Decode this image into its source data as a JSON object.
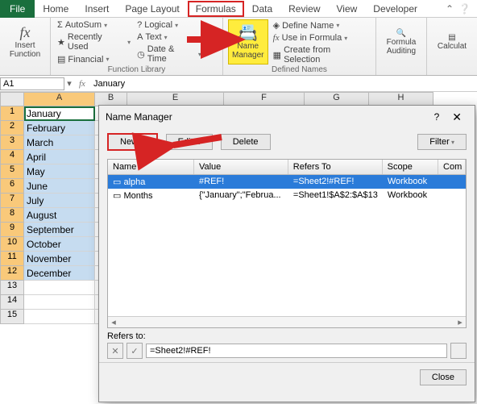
{
  "tabs": {
    "file": "File",
    "home": "Home",
    "insert": "Insert",
    "pagelayout": "Page Layout",
    "formulas": "Formulas",
    "data": "Data",
    "review": "Review",
    "view": "View",
    "developer": "Developer"
  },
  "ribbon": {
    "insert_function": "Insert Function",
    "autosum": "AutoSum",
    "recently": "Recently Used",
    "financial": "Financial",
    "logical": "Logical",
    "text": "Text",
    "datetime": "Date & Time",
    "group1": "Function Library",
    "name_manager": "Name Manager",
    "define": "Define Name",
    "usein": "Use in Formula",
    "createfrom": "Create from Selection",
    "group2": "Defined Names",
    "auditing": "Formula Auditing",
    "calc": "Calculat"
  },
  "namebox": "A1",
  "fxvalue": "January",
  "columns": [
    "A",
    "B",
    "E",
    "F",
    "G",
    "H"
  ],
  "rows": [
    "1",
    "2",
    "3",
    "4",
    "5",
    "6",
    "7",
    "8",
    "9",
    "10",
    "11",
    "12",
    "13",
    "14",
    "15"
  ],
  "months": [
    "January",
    "February",
    "March",
    "April",
    "May",
    "June",
    "July",
    "August",
    "September",
    "October",
    "November",
    "December"
  ],
  "dialog": {
    "title": "Name Manager",
    "new": "New...",
    "edit": "Edit...",
    "delete": "Delete",
    "filter": "Filter",
    "head": {
      "name": "Name",
      "value": "Value",
      "refers": "Refers To",
      "scope": "Scope",
      "com": "Com"
    },
    "items": [
      {
        "name": "alpha",
        "value": "#REF!",
        "refers": "=Sheet2!#REF!",
        "scope": "Workbook"
      },
      {
        "name": "Months",
        "value": "{\"January\";\"Februa...",
        "refers": "=Sheet1!$A$2:$A$13",
        "scope": "Workbook"
      }
    ],
    "refers_label": "Refers to:",
    "refers_value": "=Sheet2!#REF!",
    "close": "Close"
  }
}
